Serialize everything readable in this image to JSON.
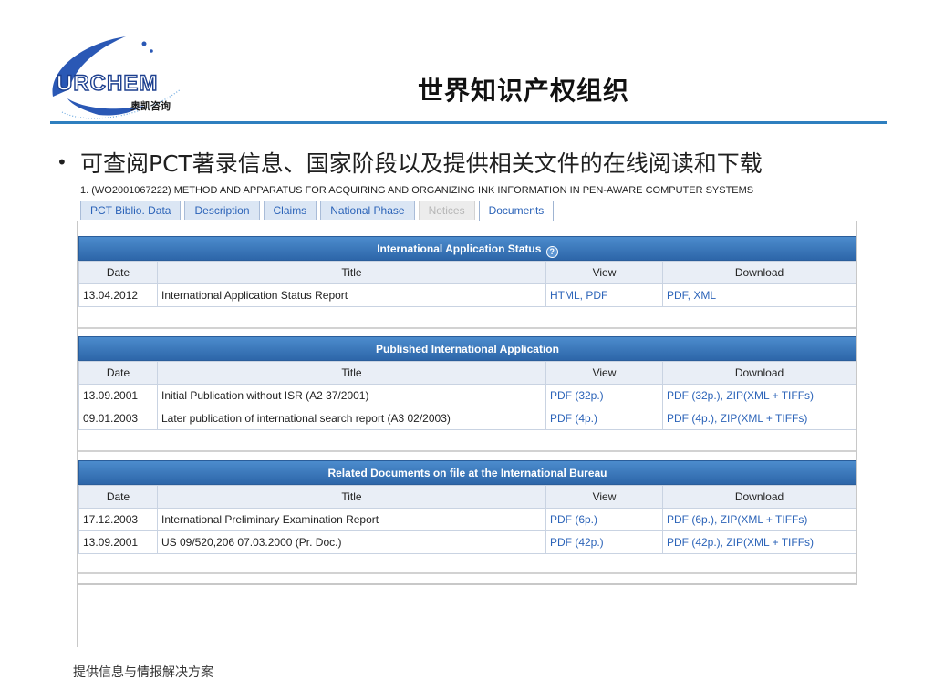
{
  "logo": {
    "brand": "URCHEM",
    "subtitle": "奥凯咨询"
  },
  "slide_title": "世界知识产权组织",
  "bullet": "可查阅PCT著录信息、国家阶段以及提供相关文件的在线阅读和下载",
  "document_heading": "1. (WO2001067222) METHOD AND APPARATUS FOR ACQUIRING AND ORGANIZING INK INFORMATION IN PEN-AWARE COMPUTER SYSTEMS",
  "tabs": [
    {
      "label": "PCT Biblio. Data"
    },
    {
      "label": "Description"
    },
    {
      "label": "Claims"
    },
    {
      "label": "National Phase"
    },
    {
      "label": "Notices"
    },
    {
      "label": "Documents"
    }
  ],
  "columns": {
    "date": "Date",
    "title": "Title",
    "view": "View",
    "download": "Download"
  },
  "sections": [
    {
      "title": "International Application Status",
      "help_icon": "?",
      "rows": [
        {
          "date": "13.04.2012",
          "title": "International Application Status Report",
          "view": "HTML, PDF",
          "download": "PDF, XML"
        }
      ]
    },
    {
      "title": "Published International Application",
      "rows": [
        {
          "date": "13.09.2001",
          "title": "Initial Publication without ISR (A2 37/2001)",
          "view": "PDF (32p.)",
          "download": "PDF (32p.), ZIP(XML + TIFFs)"
        },
        {
          "date": "09.01.2003",
          "title": "Later publication of international search report (A3 02/2003)",
          "view": "PDF (4p.)",
          "download": "PDF (4p.), ZIP(XML + TIFFs)"
        }
      ]
    },
    {
      "title": "Related Documents on file at the International Bureau",
      "rows": [
        {
          "date": "17.12.2003",
          "title": "International Preliminary Examination Report",
          "view": "PDF (6p.)",
          "download": "PDF (6p.), ZIP(XML + TIFFs)"
        },
        {
          "date": "13.09.2001",
          "title": "US 09/520,206 07.03.2000 (Pr. Doc.)",
          "view": "PDF (42p.)",
          "download": "PDF (42p.), ZIP(XML + TIFFs)"
        }
      ]
    }
  ],
  "footer": "提供信息与情报解决方案",
  "colors": {
    "accent": "#2e7fbf",
    "header_bar": "#2d66a9",
    "link": "#2b63b8"
  }
}
